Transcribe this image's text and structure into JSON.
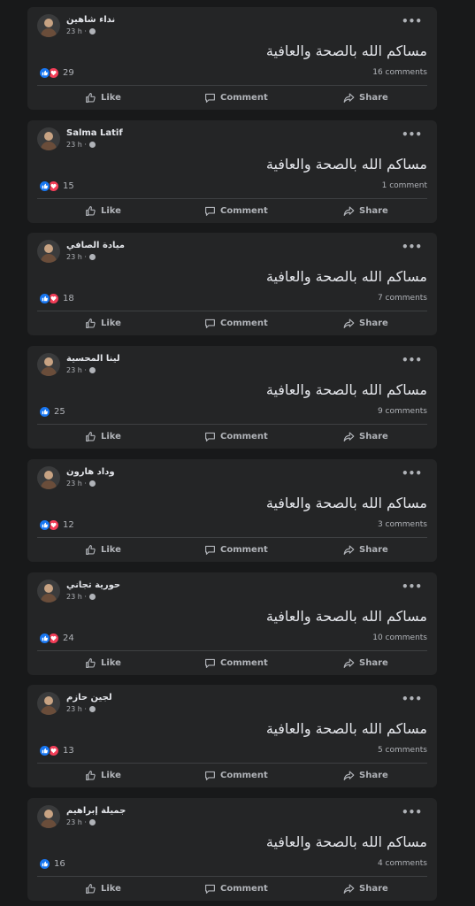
{
  "colors": {
    "page_bg": "#18191a",
    "card_bg": "#242526",
    "text_primary": "#e4e6eb",
    "text_secondary": "#b0b3b8",
    "like_blue": "#1877f2",
    "love_red": "#f33e58"
  },
  "icons": {
    "more": "more-icon",
    "globe": "globe-icon",
    "like_reaction": "like-reaction-icon",
    "love_reaction": "love-reaction-icon",
    "like_action": "thumbs-up-icon",
    "comment_action": "comment-bubble-icon",
    "share_action": "share-arrow-icon"
  },
  "actions": {
    "like": "Like",
    "comment": "Comment",
    "share": "Share",
    "more_glyph": "•••"
  },
  "posts": [
    {
      "author": "نداء شاهين",
      "time": "23 h ·",
      "text": "مساكم الله بالصحة والعافية",
      "reactions": "29",
      "has_love": true,
      "comments": "16 comments"
    },
    {
      "author": "Salma Latif",
      "time": "23 h ·",
      "text": "مساكم الله بالصحة والعافية",
      "reactions": "15",
      "has_love": true,
      "comments": "1 comment"
    },
    {
      "author": "ميادة الصافي",
      "time": "23 h ·",
      "text": "مساكم الله بالصحة والعافية",
      "reactions": "18",
      "has_love": true,
      "comments": "7 comments"
    },
    {
      "author": "لينا المحسية",
      "time": "23 h ·",
      "text": "مساكم الله بالصحة والعافية",
      "reactions": "25",
      "has_love": false,
      "comments": "9 comments"
    },
    {
      "author": "وداد هارون",
      "time": "23 h ·",
      "text": "مساكم الله بالصحة والعافية",
      "reactions": "12",
      "has_love": true,
      "comments": "3 comments"
    },
    {
      "author": "حورية تجاني",
      "time": "23 h ·",
      "text": "مساكم الله بالصحة والعافية",
      "reactions": "24",
      "has_love": true,
      "comments": "10 comments"
    },
    {
      "author": "لجين حازم",
      "time": "23 h ·",
      "text": "مساكم الله بالصحة والعافية",
      "reactions": "13",
      "has_love": true,
      "comments": "5 comments"
    },
    {
      "author": "جميلة إبراهيم",
      "time": "23 h ·",
      "text": "مساكم الله بالصحة والعافية",
      "reactions": "16",
      "has_love": false,
      "comments": "4 comments"
    }
  ]
}
